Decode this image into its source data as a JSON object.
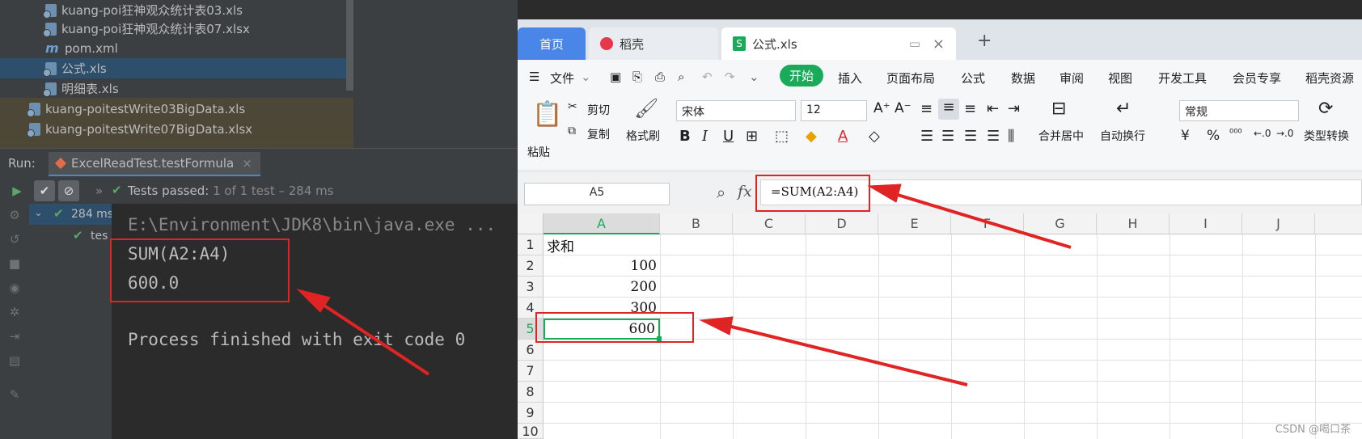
{
  "ide": {
    "tree": [
      {
        "label": "kuang-poi狂神观众统计表03.xls",
        "icon": "xls-file-icon"
      },
      {
        "label": "kuang-poi狂神观众统计表07.xlsx",
        "icon": "xls-file-icon"
      },
      {
        "label": "pom.xml",
        "icon": "maven-icon"
      },
      {
        "label": "公式.xls",
        "icon": "xls-file-icon"
      },
      {
        "label": "明细表.xls",
        "icon": "xls-file-icon"
      },
      {
        "label": "kuang-poitestWrite03BigData.xls",
        "icon": "xls-file-icon"
      },
      {
        "label": "kuang-poitestWrite07BigData.xlsx",
        "icon": "xls-file-icon"
      }
    ],
    "run_label": "Run:",
    "run_tab": "ExcelReadTest.testFormula",
    "tests_passed": "Tests passed:",
    "tests_count": "1 of 1 test – 284 ms",
    "tree_root_time": "284 ms",
    "tree_child": "tes",
    "console": {
      "cmd": "E:\\Environment\\JDK8\\bin\\java.exe ...",
      "line1": "SUM(A2:A4)",
      "line2": "600.0",
      "line3": "Process finished with exit code 0"
    }
  },
  "wps": {
    "tabs": {
      "home": "首页",
      "daoke": "稻壳",
      "file": "公式.xls"
    },
    "menu": {
      "file": "文件",
      "start": "开始",
      "insert": "插入",
      "layout": "页面布局",
      "formula": "公式",
      "data": "数据",
      "review": "审阅",
      "view": "视图",
      "dev": "开发工具",
      "member": "会员专享",
      "res": "稻壳资源"
    },
    "ribbon": {
      "paste": "粘贴",
      "cut": "剪切",
      "copy": "复制",
      "format_painter": "格式刷",
      "font": "宋体",
      "size": "12",
      "merge": "合并居中",
      "wrap": "自动换行",
      "number_format": "常规",
      "type_convert": "类型转换"
    },
    "name_box": "A5",
    "formula": "=SUM(A2:A4)",
    "columns": [
      "A",
      "B",
      "C",
      "D",
      "E",
      "F",
      "G",
      "H",
      "I",
      "J"
    ],
    "rows": [
      "1",
      "2",
      "3",
      "4",
      "5",
      "6",
      "7",
      "8",
      "9",
      "10"
    ],
    "cells": {
      "A1": "求和",
      "A2": "100",
      "A3": "200",
      "A4": "300",
      "A5": "600"
    },
    "watermark": "CSDN @喝口茶"
  },
  "colors": {
    "annotation": "#e02424",
    "accent_green": "#1aab5a",
    "ide_bg": "#2b2b2b"
  }
}
